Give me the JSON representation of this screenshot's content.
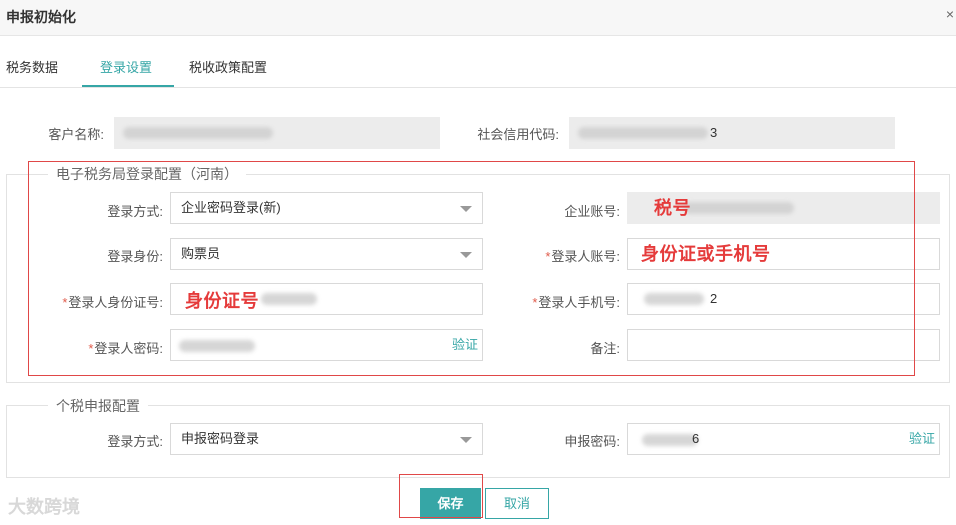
{
  "window": {
    "title": "申报初始化",
    "close_symbol": "×"
  },
  "tabs": [
    {
      "label": "税务数据",
      "active": false
    },
    {
      "label": "登录设置",
      "active": true
    },
    {
      "label": "税收政策配置",
      "active": false
    }
  ],
  "customer": {
    "name_label": "客户名称:",
    "name_value": "",
    "credit_label": "社会信用代码:",
    "credit_value_end": "3"
  },
  "etax_section": {
    "legend": "电子税务局登录配置（河南）",
    "login_method_label": "登录方式:",
    "login_method_value": "企业密码登录(新)",
    "identity_label": "登录身份:",
    "identity_value": "购票员",
    "id_card_label": "登录人身份证号:",
    "password_label": "登录人密码:",
    "password_verify": "验证",
    "company_account_label": "企业账号:",
    "login_account_label": "登录人账号:",
    "phone_label": "登录人手机号:",
    "phone_value_end": "2",
    "remark_label": "备注:",
    "required_mark": "*"
  },
  "iit_section": {
    "legend": "个税申报配置",
    "login_method_label": "登录方式:",
    "login_method_value": "申报密码登录",
    "declare_password_label": "申报密码:",
    "declare_password_end": "6",
    "declare_verify": "验证"
  },
  "annotations": {
    "tax_no": "税号",
    "id_or_phone": "身份证或手机号",
    "id_card": "身份证号"
  },
  "buttons": {
    "save": "保存",
    "cancel": "取消"
  },
  "watermark": "大数跨境",
  "colors": {
    "accent": "#36a6a6",
    "annotation_red": "#e53b3b"
  }
}
